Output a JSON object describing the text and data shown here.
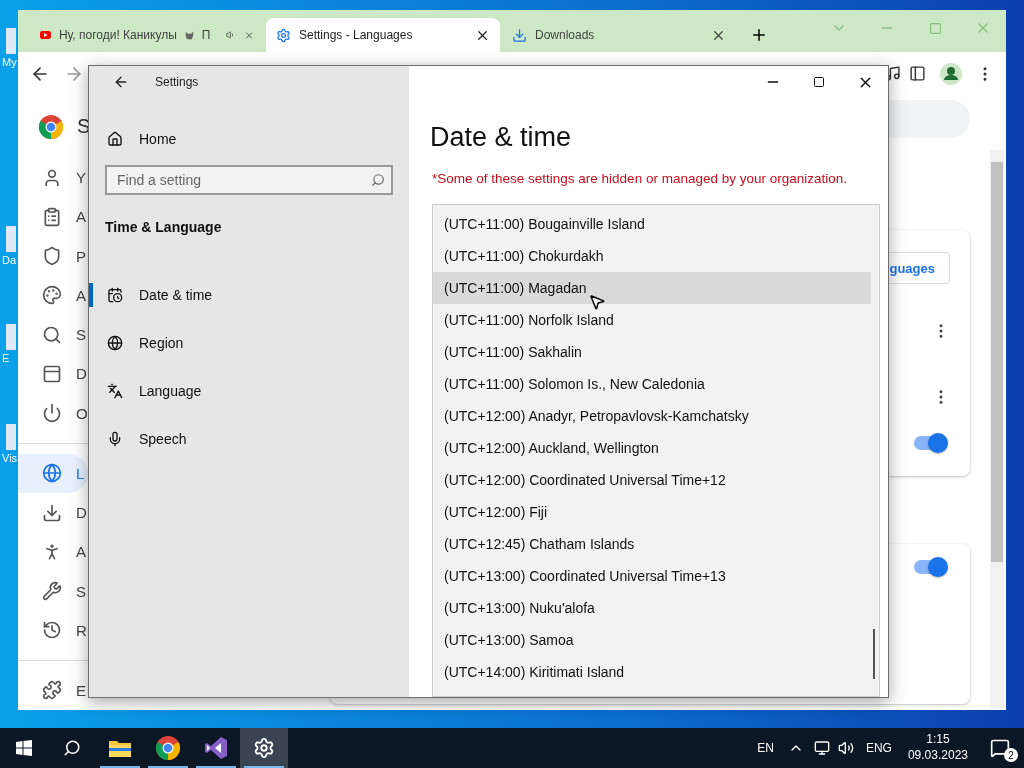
{
  "desktop": {
    "icons": [
      {
        "label": "My"
      },
      {
        "label": "Da"
      },
      {
        "label": "E"
      },
      {
        "label": "Vis"
      }
    ]
  },
  "browser": {
    "tabs": [
      {
        "title": "Ну, погоди! Каникулы",
        "title_end": "П",
        "audio": true,
        "selected": false
      },
      {
        "title": "Settings - Languages",
        "audio": false,
        "selected": true
      },
      {
        "title": "Downloads",
        "audio": false,
        "selected": false
      }
    ],
    "sidebar": {
      "header": "S",
      "items": [
        {
          "label": "Y",
          "selected": false
        },
        {
          "label": "A",
          "selected": false
        },
        {
          "label": "P",
          "selected": false
        },
        {
          "label": "A",
          "selected": false
        },
        {
          "label": "S",
          "selected": false
        },
        {
          "label": "D",
          "selected": false
        },
        {
          "label": "O",
          "selected": false
        },
        {
          "label": "L",
          "selected": true
        },
        {
          "label": "D",
          "selected": false
        },
        {
          "label": "A",
          "selected": false
        },
        {
          "label": "S",
          "selected": false
        },
        {
          "label": "R",
          "selected": false
        },
        {
          "label": "E",
          "selected": false
        }
      ]
    },
    "language_button": "guages",
    "toggles": [
      {
        "on": true
      },
      {
        "on": true
      }
    ]
  },
  "settings_window": {
    "title": "Settings",
    "nav": {
      "home": "Home",
      "search": {
        "placeholder": "Find a setting"
      },
      "section": "Time & Language",
      "items": [
        {
          "label": "Date & time",
          "selected": true
        },
        {
          "label": "Region",
          "selected": false
        },
        {
          "label": "Language",
          "selected": false
        },
        {
          "label": "Speech",
          "selected": false
        }
      ]
    },
    "page": {
      "title": "Date & time",
      "notice": "*Some of these settings are hidden or managed by your organization.",
      "timezones": [
        {
          "label": "(UTC+11:00) Bougainville Island",
          "selected": false
        },
        {
          "label": "(UTC+11:00) Chokurdakh",
          "selected": false
        },
        {
          "label": "(UTC+11:00) Magadan",
          "selected": true
        },
        {
          "label": "(UTC+11:00) Norfolk Island",
          "selected": false
        },
        {
          "label": "(UTC+11:00) Sakhalin",
          "selected": false
        },
        {
          "label": "(UTC+11:00) Solomon Is., New Caledonia",
          "selected": false
        },
        {
          "label": "(UTC+12:00) Anadyr, Petropavlovsk-Kamchatsky",
          "selected": false
        },
        {
          "label": "(UTC+12:00) Auckland, Wellington",
          "selected": false
        },
        {
          "label": "(UTC+12:00) Coordinated Universal Time+12",
          "selected": false
        },
        {
          "label": "(UTC+12:00) Fiji",
          "selected": false
        },
        {
          "label": "(UTC+12:45) Chatham Islands",
          "selected": false
        },
        {
          "label": "(UTC+13:00) Coordinated Universal Time+13",
          "selected": false
        },
        {
          "label": "(UTC+13:00) Nuku'alofa",
          "selected": false
        },
        {
          "label": "(UTC+13:00) Samoa",
          "selected": false
        },
        {
          "label": "(UTC+14:00) Kiritimati Island",
          "selected": false
        }
      ]
    }
  },
  "taskbar": {
    "apps": [
      {
        "kind": "folder",
        "selected": false
      },
      {
        "kind": "chrome",
        "selected": false
      },
      {
        "kind": "studio",
        "selected": false
      },
      {
        "kind": "settings",
        "selected": true
      }
    ],
    "input": "EN",
    "language": "ENG",
    "time": "1:15",
    "date": "09.03.2023",
    "notifications": "2"
  }
}
